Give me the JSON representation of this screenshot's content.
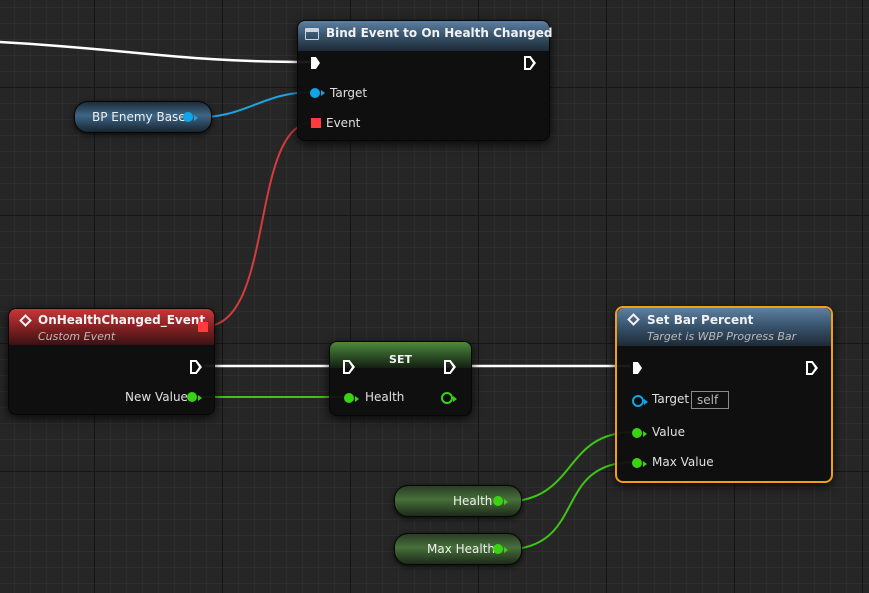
{
  "nodes": {
    "bind": {
      "title": "Bind Event to On Health Changed",
      "target_label": "Target",
      "event_label": "Event"
    },
    "custom_event": {
      "title": "OnHealthChanged_Event",
      "subtitle": "Custom Event",
      "new_value_label": "New Value"
    },
    "set": {
      "title": "SET",
      "health_label": "Health"
    },
    "set_bar": {
      "title": "Set Bar Percent",
      "subtitle": "Target is WBP Progress Bar",
      "target_label": "Target",
      "target_default": "self",
      "value_label": "Value",
      "max_value_label": "Max Value"
    }
  },
  "variables": {
    "bp_enemy": "BP Enemy Base",
    "health": "Health",
    "max_health": "Max Health"
  },
  "colors": {
    "exec": "#ffffff",
    "float_pin": "#38d411",
    "object_pin": "#0ea5e9",
    "delegate_pin": "#ff3b3b",
    "selected_outline": "#f0a018",
    "grid_bg": "#262626"
  },
  "icons": {
    "bind_header": "function-icon",
    "custom_event_header": "event-diamond-icon",
    "set_bar_header": "function-diamond-icon"
  }
}
